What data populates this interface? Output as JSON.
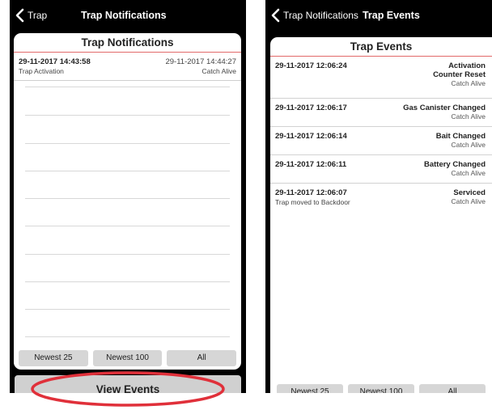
{
  "left_screen": {
    "nav": {
      "back_label": "Trap",
      "title": "Trap Notifications"
    },
    "card_title": "Trap Notifications",
    "notification": {
      "datetime": "29-11-2017 14:43:58",
      "type": "Trap Activation",
      "right_datetime": "29-11-2017 14:44:27",
      "right_status": "Catch Alive"
    },
    "filters": [
      "Newest 25",
      "Newest 100",
      "All"
    ],
    "view_events_label": "View Events"
  },
  "right_screen": {
    "nav": {
      "back_label": "Trap Notifications",
      "title": "Trap Events"
    },
    "card_title": "Trap Events",
    "events": [
      {
        "datetime": "29-11-2017 12:06:24",
        "sub": "",
        "name_line1": "Activation",
        "name_line2": "Counter Reset",
        "status": "Catch Alive"
      },
      {
        "datetime": "29-11-2017 12:06:17",
        "sub": "",
        "name_line1": "Gas Canister Changed",
        "name_line2": "",
        "status": "Catch Alive"
      },
      {
        "datetime": "29-11-2017 12:06:14",
        "sub": "",
        "name_line1": "Bait Changed",
        "name_line2": "",
        "status": "Catch Alive"
      },
      {
        "datetime": "29-11-2017 12:06:11",
        "sub": "",
        "name_line1": "Battery Changed",
        "name_line2": "",
        "status": "Catch Alive"
      },
      {
        "datetime": "29-11-2017 12:06:07",
        "sub": "Trap moved to Backdoor",
        "name_line1": "Serviced",
        "name_line2": "",
        "status": "Catch Alive"
      }
    ],
    "filters": [
      "Newest 25",
      "Newest 100",
      "All"
    ]
  },
  "colors": {
    "phone_bg": "#000000",
    "card_bg": "#ffffff",
    "title_divider": "#e26a6a",
    "button_bg": "#d6d6d6",
    "highlight_ellipse": "#e0303a"
  },
  "icons": {
    "back": "chevron-left-icon"
  }
}
